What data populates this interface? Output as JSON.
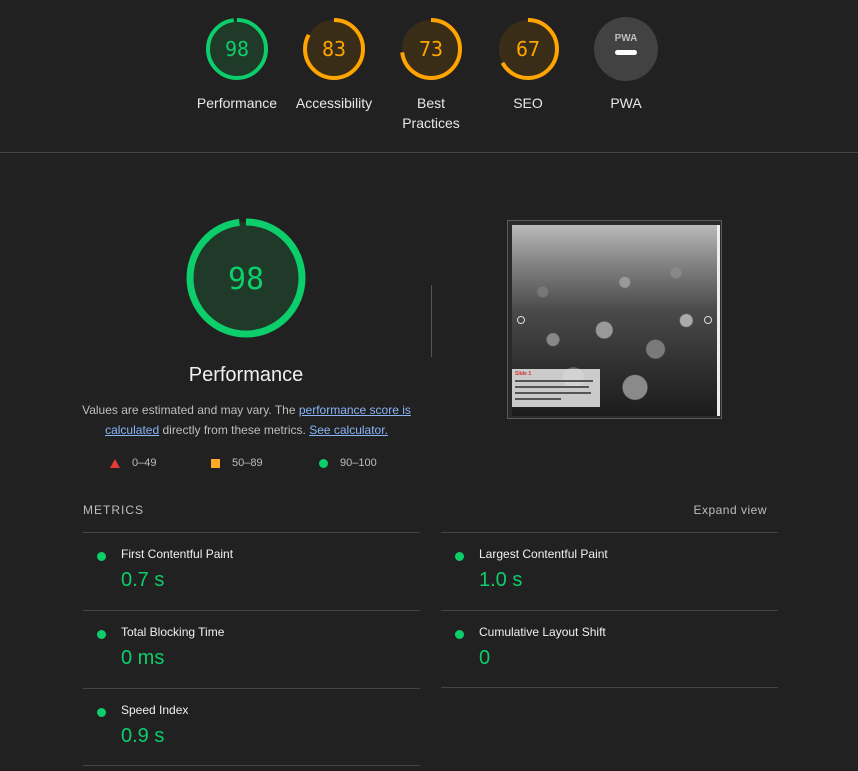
{
  "categories": [
    {
      "label": "Performance",
      "score": "98",
      "value": 98,
      "color": "#0cce6b",
      "bg": "#1f3a28"
    },
    {
      "label": "Accessibility",
      "score": "83",
      "value": 83,
      "color": "#ffa400",
      "bg": "#3a2d18"
    },
    {
      "label": "Best Practices",
      "score": "73",
      "value": 73,
      "color": "#ffa400",
      "bg": "#3a2d18"
    },
    {
      "label": "SEO",
      "score": "67",
      "value": 67,
      "color": "#ffa400",
      "bg": "#3a2d18"
    },
    {
      "label": "PWA",
      "badge": "PWA",
      "icon": "pwa-dash-icon"
    }
  ],
  "performance": {
    "score": "98",
    "value": 98,
    "title": "Performance",
    "desc_prefix": "Values are estimated and may vary. The ",
    "link_score": "performance score is calculated",
    "desc_mid": " directly from these metrics. ",
    "link_calc": "See calculator."
  },
  "legend": [
    {
      "label": "0–49",
      "icon": "triangle-red"
    },
    {
      "label": "50–89",
      "icon": "square-orange"
    },
    {
      "label": "90–100",
      "icon": "circle-green"
    }
  ],
  "screenshot": {
    "caption_title": "Slide 1"
  },
  "metrics": {
    "title": "METRICS",
    "expand": "Expand view",
    "items": [
      {
        "name": "First Contentful Paint",
        "value": "0.7 s"
      },
      {
        "name": "Largest Contentful Paint",
        "value": "1.0 s"
      },
      {
        "name": "Total Blocking Time",
        "value": "0 ms"
      },
      {
        "name": "Cumulative Layout Shift",
        "value": "0"
      },
      {
        "name": "Speed Index",
        "value": "0.9 s"
      }
    ]
  },
  "colors": {
    "pass": "#0cce6b",
    "average": "#ffa400",
    "fail": "#e53935"
  }
}
